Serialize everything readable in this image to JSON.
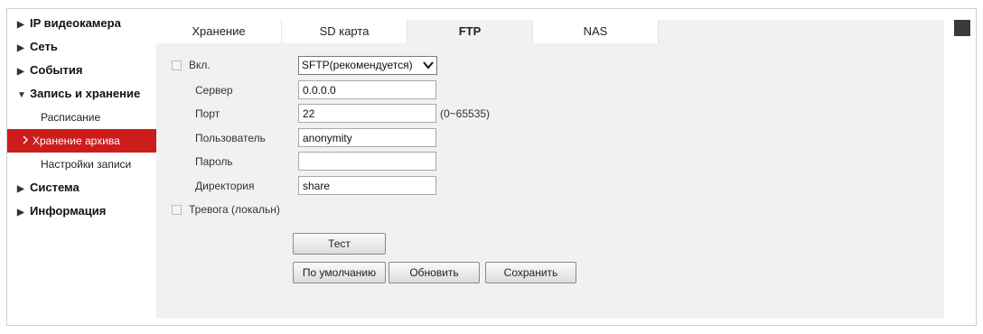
{
  "sidebar": {
    "items": [
      {
        "label": "IP видеокамера",
        "arrow": "▶"
      },
      {
        "label": "Сеть",
        "arrow": "▶"
      },
      {
        "label": "События",
        "arrow": "▶"
      },
      {
        "label": "Запись и хранение",
        "arrow": "▼"
      }
    ],
    "sub_items": [
      {
        "label": "Расписание"
      },
      {
        "label": "Хранение архива",
        "active": true
      },
      {
        "label": "Настройки записи"
      }
    ],
    "items_after": [
      {
        "label": "Система",
        "arrow": "▶"
      },
      {
        "label": "Информация",
        "arrow": "▶"
      }
    ],
    "active_color": "#cc1c1c"
  },
  "tabs": [
    {
      "label": "Хранение"
    },
    {
      "label": "SD карта"
    },
    {
      "label": "FTP",
      "active": true
    },
    {
      "label": "NAS"
    }
  ],
  "form": {
    "enable_label": "Вкл.",
    "enable_checked": false,
    "protocol_value": "SFTP(рекомендуется)",
    "server_label": "Сервер",
    "server_value": "0.0.0.0",
    "port_label": "Порт",
    "port_value": "22",
    "port_hint": "(0~65535)",
    "user_label": "Пользователь",
    "user_value": "anonymity",
    "password_label": "Пароль",
    "password_value": "",
    "directory_label": "Директория",
    "directory_value": "share",
    "alarm_label": "Тревога (локальн)",
    "alarm_checked": false
  },
  "buttons": {
    "test": "Тест",
    "default": "По умолчанию",
    "refresh": "Обновить",
    "save": "Сохранить"
  }
}
